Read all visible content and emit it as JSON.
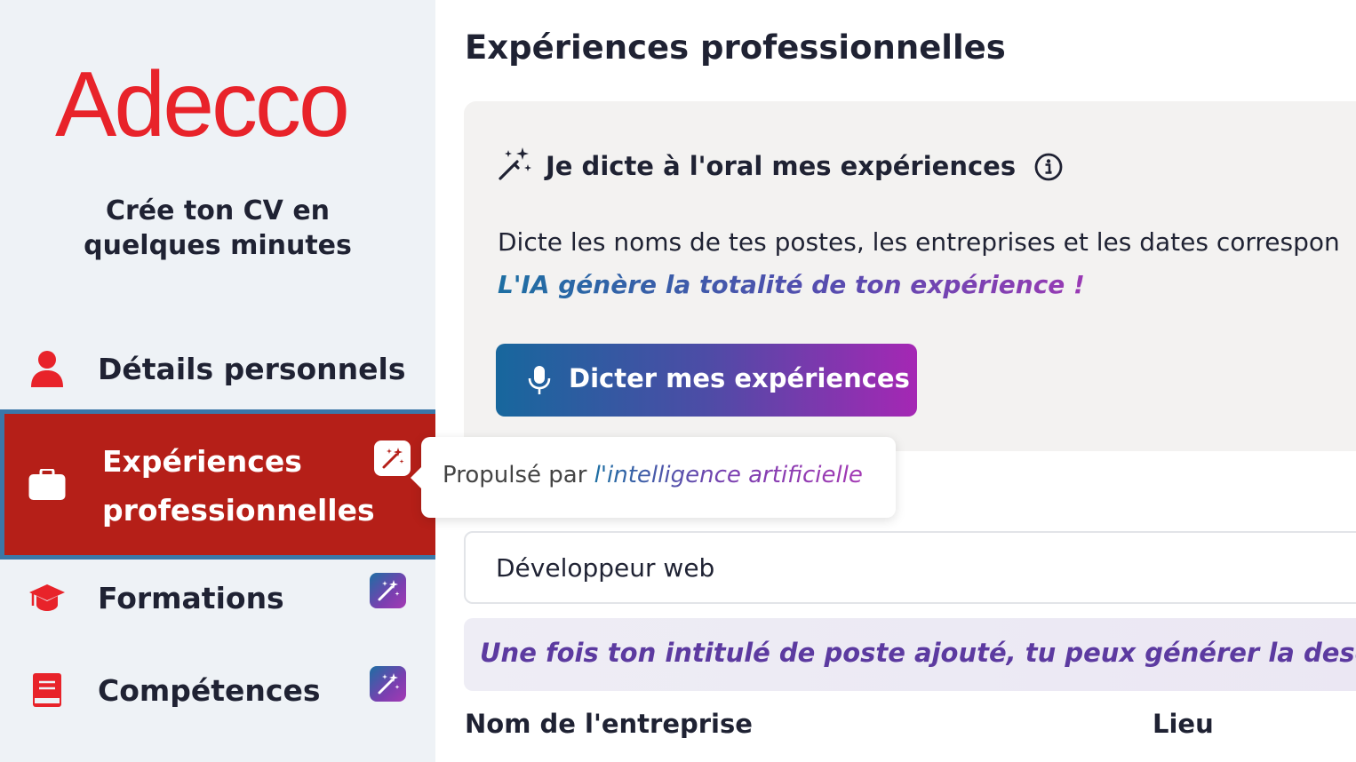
{
  "brand": {
    "logo_text": "Adecco",
    "color": "#e8232a"
  },
  "sidebar": {
    "tagline": "Crée ton CV en quelques minutes",
    "items": [
      {
        "label": "Détails personnels",
        "icon": "user-icon",
        "active": false,
        "ai": false
      },
      {
        "label": "Expériences professionnelles",
        "icon": "briefcase-icon",
        "active": true,
        "ai": true
      },
      {
        "label": "Formations",
        "icon": "graduation-cap-icon",
        "active": false,
        "ai": true
      },
      {
        "label": "Compétences",
        "icon": "book-icon",
        "active": false,
        "ai": true
      }
    ],
    "active_bg": "#b51f18"
  },
  "tooltip": {
    "prefix": "Propulsé par ",
    "emphasis": "l'intelligence artificielle"
  },
  "main": {
    "title": "Expériences professionnelles",
    "ai_card": {
      "title": "Je dicte à l'oral mes expériences",
      "description": "Dicte les noms de tes postes, les entreprises et les dates correspon",
      "emphasis": "L'IA génère la totalité de ton expérience !",
      "button_label": "Dicter mes expériences"
    },
    "job_title_value": "Développeur web",
    "hint": "Une fois ton intitulé de poste ajouté, tu peux générer la descriptio",
    "company_label": "Nom de l'entreprise",
    "location_label": "Lieu"
  }
}
